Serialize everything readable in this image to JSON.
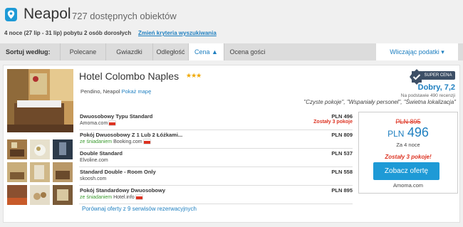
{
  "header": {
    "city": "Neapol",
    "count": "727 dostępnych obiektów",
    "stay_info": "4 noce (27 lip - 31 lip) pobytu 2 osób dorosłych",
    "change_link": "Zmień kryteria wyszukiwania"
  },
  "sort": {
    "label": "Sortuj według:",
    "options": [
      "Polecane",
      "Gwiazdki",
      "Odległość od",
      "Cena ▲",
      "Ocena gości"
    ],
    "active": "Cena",
    "tax_toggle": "Wliczając podatki ▾"
  },
  "hotel": {
    "name": "Hotel Colombo Naples",
    "stars": "★★★",
    "location": "Pendino, Neapol",
    "map_link": "Pokaż mapę",
    "badge": "SUPER CENA",
    "rating": "Dobry, 7,2",
    "reviews": "Na podstawie 490 recenzji",
    "quotes": "\"Czyste pokoje\", \"Wspaniały personel\", \"Świetna lokalizacja\"",
    "deals": [
      {
        "name": "Dwuosobowy Typu Standard",
        "breakfast": "",
        "provider": "Amoma.com",
        "price": "PLN 496",
        "rooms_left": "Zostały 3 pokoje"
      },
      {
        "name": "Pokój Dwuosobowy Z 1 Lub 2 Łóżkami...",
        "breakfast": "ze śniadaniem",
        "provider": "Booking.com",
        "price": "PLN 809",
        "rooms_left": ""
      },
      {
        "name": "Double Standard",
        "breakfast": "",
        "provider": "Elvoline.com",
        "price": "PLN 537",
        "rooms_left": ""
      },
      {
        "name": "Standard Double - Room Only",
        "breakfast": "",
        "provider": "skoosh.com",
        "price": "PLN 558",
        "rooms_left": ""
      },
      {
        "name": "Pokój Standardowy Dwuosobowy",
        "breakfast": "ze śniadaniem",
        "provider": "Hotel.info",
        "price": "PLN 895",
        "rooms_left": ""
      }
    ],
    "compare_link": "Porównaj oferty z 9 serwisów rezerwacyjnych"
  },
  "offer": {
    "old_price": "PLN 895",
    "currency": "PLN",
    "price": "496",
    "nights": "Za 4 noce",
    "rooms_left": "Zostały 3 pokoje!",
    "cta": "Zobacz ofertę",
    "provider": "Amoma.com"
  },
  "colors": {
    "accent": "#1e9ad6",
    "link": "#1e7fc0",
    "alert": "#dd3322"
  }
}
